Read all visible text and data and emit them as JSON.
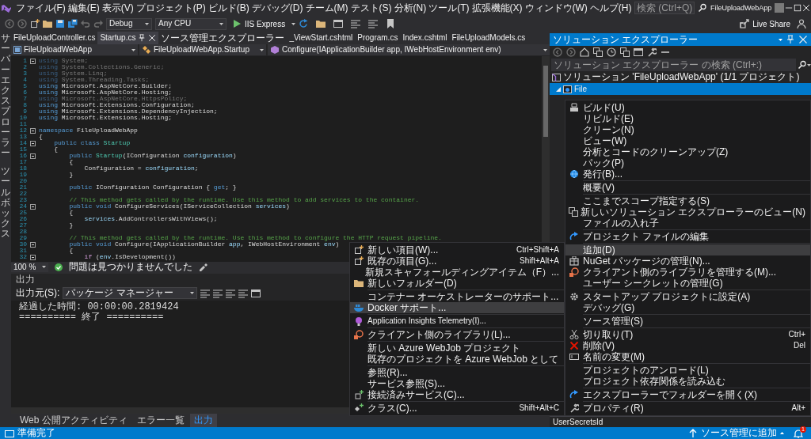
{
  "menu_bar": {
    "items": [
      "ファイル(F)",
      "編集(E)",
      "表示(V)",
      "プロジェクト(P)",
      "ビルド(B)",
      "デバッグ(D)",
      "チーム(M)",
      "テスト(S)",
      "分析(N)",
      "ツール(T)",
      "拡張機能(X)",
      "ウィンドウ(W)",
      "ヘルプ(H)"
    ],
    "search": {
      "placeholder": "検索 (Ctrl+Q)"
    },
    "title": "FileUploadWebApp"
  },
  "toolbar": {
    "configuration": "Debug",
    "platform": "Any CPU",
    "start": "IIS Express",
    "live_share": "Live Share"
  },
  "side_tabs": [
    "サーバーエクスプローラー",
    "ツールボックス"
  ],
  "editor": {
    "tabs": [
      {
        "label": "FileUploadController.cs",
        "selected": false
      },
      {
        "label": "Startup.cs",
        "selected": true
      },
      {
        "label": "ソース管理エクスプローラー",
        "selected": false
      },
      {
        "label": "_ViewStart.cshtml",
        "selected": false
      },
      {
        "label": "Program.cs",
        "selected": false
      },
      {
        "label": "Index.cshtml",
        "selected": false
      },
      {
        "label": "FileUploadModels.cs",
        "selected": false
      }
    ],
    "navigation": [
      "FileUploadWebApp",
      "FileUploadWebApp.Startup",
      "Configure(IApplicationBuilder app, IWebHostEnvironment env)"
    ],
    "lines": [
      {
        "number": "1",
        "fold": true,
        "segments": [
          {
            "kind": "faded-keyword",
            "text": "using"
          },
          {
            "kind": "faded",
            "text": " System;"
          }
        ]
      },
      {
        "number": "2",
        "fold": false,
        "segments": [
          {
            "kind": "faded-keyword",
            "text": "using"
          },
          {
            "kind": "faded",
            "text": " System.Collections.Generic;"
          }
        ]
      },
      {
        "number": "3",
        "fold": false,
        "segments": [
          {
            "kind": "faded-keyword",
            "text": "using"
          },
          {
            "kind": "faded",
            "text": " System.Linq;"
          }
        ]
      },
      {
        "number": "4",
        "fold": false,
        "segments": [
          {
            "kind": "faded-keyword",
            "text": "using"
          },
          {
            "kind": "faded",
            "text": " System.Threading.Tasks;"
          }
        ]
      },
      {
        "number": "5",
        "fold": false,
        "segments": [
          {
            "kind": "keyword",
            "text": "using"
          },
          {
            "kind": "plain",
            "text": " Microsoft.AspNetCore.Builder;"
          }
        ]
      },
      {
        "number": "6",
        "fold": false,
        "segments": [
          {
            "kind": "keyword",
            "text": "using"
          },
          {
            "kind": "plain",
            "text": " Microsoft.AspNetCore.Hosting;"
          }
        ]
      },
      {
        "number": "7",
        "fold": false,
        "segments": [
          {
            "kind": "faded-keyword",
            "text": "using"
          },
          {
            "kind": "faded",
            "text": " Microsoft.AspNetCore.HttpsPolicy;"
          }
        ]
      },
      {
        "number": "8",
        "fold": false,
        "segments": [
          {
            "kind": "keyword",
            "text": "using"
          },
          {
            "kind": "plain",
            "text": " Microsoft.Extensions.Configuration;"
          }
        ]
      },
      {
        "number": "9",
        "fold": false,
        "segments": [
          {
            "kind": "keyword",
            "text": "using"
          },
          {
            "kind": "plain",
            "text": " Microsoft.Extensions.DependencyInjection;"
          }
        ]
      },
      {
        "number": "10",
        "fold": false,
        "segments": [
          {
            "kind": "keyword",
            "text": "using"
          },
          {
            "kind": "plain",
            "text": " Microsoft.Extensions.Hosting;"
          }
        ]
      },
      {
        "number": "11",
        "fold": false
      },
      {
        "number": "12",
        "fold": true,
        "segments": [
          {
            "kind": "keyword",
            "text": "namespace"
          },
          {
            "kind": "plain",
            "text": " FileUploadWebApp"
          }
        ]
      },
      {
        "number": "13",
        "fold": false,
        "segments": [
          {
            "kind": "plain",
            "text": "{"
          }
        ]
      },
      {
        "number": "14",
        "fold": true,
        "segments": [
          {
            "kind": "keyword",
            "text": "    public class"
          },
          {
            "kind": "type",
            "text": " Startup"
          }
        ]
      },
      {
        "number": "15",
        "fold": false,
        "segments": [
          {
            "kind": "plain",
            "text": "    {"
          }
        ]
      },
      {
        "number": "16",
        "fold": true,
        "segments": [
          {
            "kind": "keyword",
            "text": "        public"
          },
          {
            "kind": "type",
            "text": " Startup"
          },
          {
            "kind": "plain",
            "text": "(IConfiguration "
          },
          {
            "kind": "parameter",
            "text": "configuration"
          },
          {
            "kind": "plain",
            "text": ")"
          }
        ]
      },
      {
        "number": "17",
        "fold": false,
        "segments": [
          {
            "kind": "plain",
            "text": "        {"
          }
        ]
      },
      {
        "number": "18",
        "fold": false,
        "segments": [
          {
            "kind": "plain",
            "text": "            Configuration = "
          },
          {
            "kind": "parameter",
            "text": "configuration"
          },
          {
            "kind": "plain",
            "text": ";"
          }
        ]
      },
      {
        "number": "19",
        "fold": false,
        "segments": [
          {
            "kind": "plain",
            "text": "        }"
          }
        ]
      },
      {
        "number": "20",
        "fold": false
      },
      {
        "number": "21",
        "fold": false,
        "segments": [
          {
            "kind": "keyword",
            "text": "        public"
          },
          {
            "kind": "plain",
            "text": " IConfiguration Configuration { "
          },
          {
            "kind": "keyword",
            "text": "get"
          },
          {
            "kind": "plain",
            "text": "; }"
          }
        ]
      },
      {
        "number": "22",
        "fold": false
      },
      {
        "number": "23",
        "fold": false,
        "segments": [
          {
            "kind": "comment",
            "text": "        // This method gets called by the runtime. Use this method to add services to the container."
          }
        ]
      },
      {
        "number": "24",
        "fold": true,
        "segments": [
          {
            "kind": "keyword",
            "text": "        public void"
          },
          {
            "kind": "plain",
            "text": " ConfigureServices(IServiceCollection "
          },
          {
            "kind": "parameter",
            "text": "services"
          },
          {
            "kind": "plain",
            "text": ")"
          }
        ]
      },
      {
        "number": "25",
        "fold": false,
        "segments": [
          {
            "kind": "plain",
            "text": "        {"
          }
        ]
      },
      {
        "number": "26",
        "fold": false,
        "segments": [
          {
            "kind": "parameter",
            "text": "            services"
          },
          {
            "kind": "plain",
            "text": ".AddControllersWithViews();"
          }
        ]
      },
      {
        "number": "27",
        "fold": false,
        "segments": [
          {
            "kind": "plain",
            "text": "        }"
          }
        ]
      },
      {
        "number": "28",
        "fold": false
      },
      {
        "number": "29",
        "fold": false,
        "segments": [
          {
            "kind": "comment",
            "text": "        // This method gets called by the runtime. Use this method to configure the HTTP request pipeline."
          }
        ]
      },
      {
        "number": "30",
        "fold": true,
        "segments": [
          {
            "kind": "keyword",
            "text": "        public void"
          },
          {
            "kind": "plain",
            "text": " Configure(IApplicationBuilder "
          },
          {
            "kind": "parameter",
            "text": "app"
          },
          {
            "kind": "plain",
            "text": ", IWebHostEnvironment "
          },
          {
            "kind": "parameter",
            "text": "env"
          },
          {
            "kind": "plain",
            "text": ")"
          }
        ]
      },
      {
        "number": "31",
        "fold": false,
        "segments": [
          {
            "kind": "plain",
            "text": "        {"
          }
        ]
      },
      {
        "number": "32",
        "fold": true,
        "segments": [
          {
            "kind": "control",
            "text": "            if"
          },
          {
            "kind": "plain",
            "text": " ("
          },
          {
            "kind": "parameter",
            "text": "env"
          },
          {
            "kind": "plain",
            "text": ".IsDevelopment())"
          }
        ]
      }
    ],
    "zoom": "100 %",
    "issues": "問題は見つかりませんでした"
  },
  "output": {
    "title": "出力",
    "source_label": "出力元(S):",
    "source": "パッケージ マネージャー",
    "lines": [
      "経過した時間: 00:00:00.2819424",
      "========== 終了 =========="
    ]
  },
  "bottom_tabs": [
    {
      "label": "Web 公開アクティビティ",
      "selected": false
    },
    {
      "label": "エラー一覧",
      "selected": false
    },
    {
      "label": "出力",
      "selected": true
    }
  ],
  "solution_explorer": {
    "title": "ソリューション エクスプローラー",
    "search": {
      "placeholder": "ソリューション エクスプローラー の検索 (Ctrl+:)"
    },
    "tree": {
      "label": "ソリューション 'FileUploadWebApp' (1/1 プロジェクト)",
      "children": [
        {
          "label": "File",
          "selected": true,
          "expanded": true
        }
      ]
    },
    "properties": [
      "UserSecretsId"
    ]
  },
  "context_menu": {
    "groups": [
      [
        {
          "label": "ビルド(U)",
          "selected": false
        },
        {
          "label": "リビルド(E)",
          "selected": false
        },
        {
          "label": "クリーン(N)",
          "selected": false
        },
        {
          "label": "ビュー(W)",
          "selected": false
        },
        {
          "label": "分析とコードのクリーンアップ(Z)",
          "selected": false
        },
        {
          "label": "パック(P)",
          "selected": false
        },
        {
          "label": "発行(B)...",
          "selected": false
        }
      ],
      [
        {
          "label": "概要(V)",
          "selected": false
        }
      ],
      [
        {
          "label": "ここまでスコープ指定する(S)",
          "selected": false
        },
        {
          "label": "新しいソリューション エクスプローラーのビュー(N)",
          "selected": false
        },
        {
          "label": "ファイルの入れ子",
          "selected": false
        }
      ],
      [
        {
          "label": "プロジェクト ファイルの編集",
          "selected": false
        }
      ],
      [
        {
          "label": "追加(D)",
          "selected": true
        },
        {
          "label": "NuGet パッケージの管理(N)...",
          "selected": false
        },
        {
          "label": "クライアント側のライブラリを管理する(M)...",
          "selected": false
        },
        {
          "label": "ユーザー シークレットの管理(G)",
          "selected": false
        }
      ],
      [
        {
          "label": "スタートアップ プロジェクトに設定(A)",
          "selected": false
        },
        {
          "label": "デバッグ(G)",
          "selected": false
        }
      ],
      [
        {
          "label": "ソース管理(S)",
          "selected": false
        }
      ],
      [
        {
          "label": "切り取り(T)",
          "shortcut": "Ctrl+",
          "selected": false
        },
        {
          "label": "削除(V)",
          "shortcut": "Del",
          "selected": false
        },
        {
          "label": "名前の変更(M)",
          "selected": false
        }
      ],
      [
        {
          "label": "プロジェクトのアンロード(L)",
          "selected": false
        },
        {
          "label": "プロジェクト依存関係を読み込む",
          "selected": false
        }
      ],
      [
        {
          "label": "エクスプローラーでフォルダーを開く(X)",
          "selected": false
        }
      ],
      [
        {
          "label": "プロパティ(R)",
          "shortcut": "Alt+",
          "selected": false
        }
      ]
    ]
  },
  "submenu": {
    "groups": [
      [
        {
          "label": "新しい項目(W)...",
          "shortcut": "Ctrl+Shift+A",
          "selected": false
        },
        {
          "label": "既存の項目(G)...",
          "shortcut": "Shift+Alt+A",
          "selected": false
        },
        {
          "label": "新規スキャフォールディングアイテム（F）...",
          "selected": false
        },
        {
          "label": "新しいフォルダー(D)",
          "selected": false
        }
      ],
      [
        {
          "label": "コンテナー オーケストレーターのサポート...",
          "selected": false
        },
        {
          "label": "Docker サポート...",
          "selected": true
        }
      ],
      [
        {
          "label": "Application Insights Telemetry(I)...",
          "selected": false
        }
      ],
      [
        {
          "label": "クライアント側のライブラリ(L)...",
          "selected": false
        }
      ],
      [
        {
          "label": "新しい Azure WebJob プロジェクト",
          "selected": false
        },
        {
          "label": "既存のプロジェクトを Azure WebJob として",
          "selected": false
        }
      ],
      [
        {
          "label": "参照(R)...",
          "selected": false
        },
        {
          "label": "サービス参照(S)...",
          "selected": false
        },
        {
          "label": "接続済みサービス(C)...",
          "selected": false
        }
      ],
      [
        {
          "label": "クラス(C)...",
          "shortcut": "Shift+Alt+C",
          "selected": false
        }
      ]
    ]
  },
  "status_bar": {
    "text": "準備完了",
    "source_control": "ソース管理に追加",
    "notifications": "1"
  }
}
